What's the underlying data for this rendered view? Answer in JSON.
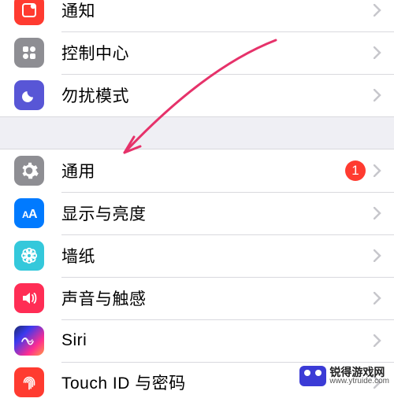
{
  "group1": {
    "items": [
      {
        "label": "通知",
        "icon": "notification-icon",
        "color": "ic-red"
      },
      {
        "label": "控制中心",
        "icon": "control-center-icon",
        "color": "ic-grey"
      },
      {
        "label": "勿扰模式",
        "icon": "do-not-disturb-icon",
        "color": "ic-purple"
      }
    ]
  },
  "group2": {
    "items": [
      {
        "label": "通用",
        "icon": "general-icon",
        "color": "ic-grey",
        "badge": "1"
      },
      {
        "label": "显示与亮度",
        "icon": "display-icon",
        "color": "ic-blue"
      },
      {
        "label": "墙纸",
        "icon": "wallpaper-icon",
        "color": "ic-teal"
      },
      {
        "label": "声音与触感",
        "icon": "sounds-icon",
        "color": "ic-pink"
      },
      {
        "label": "Siri",
        "icon": "siri-icon",
        "color": "ic-siri"
      },
      {
        "label": "Touch ID 与密码",
        "icon": "touchid-icon",
        "color": "ic-red"
      }
    ]
  },
  "watermark": {
    "line1": "锐得游戏网",
    "line2": "www.ytruide.com"
  }
}
